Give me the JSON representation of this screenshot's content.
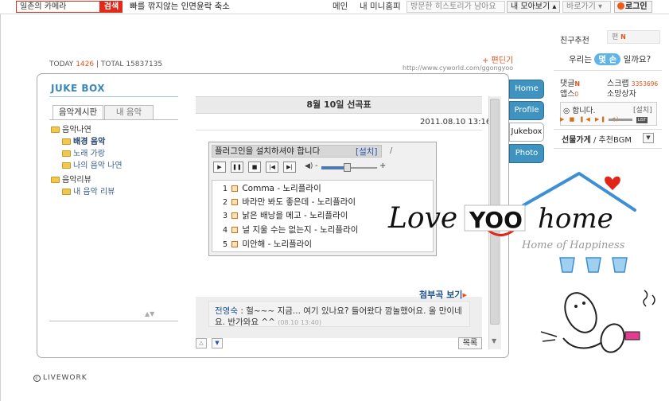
{
  "topbar": {
    "search_value": "일촌의 카메라",
    "search_button": "검색",
    "news": "빠를 깎지않는 인면윤락 축소",
    "nav_main": "메인",
    "nav_minihompy": "내 미니홈피",
    "history_placeholder": "방문한 히스토리가 남아요",
    "collect": "내 모아보기",
    "shortcut": "바로가기",
    "login": "로그인"
  },
  "counter": {
    "today_label": "TODAY",
    "today_value": "1426",
    "total_label": "TOTAL",
    "total_value": "15837135"
  },
  "url": "http://www.cyworld.com/ggongyoo",
  "edit_link": "+ 편딘기",
  "jukebox": {
    "title": "JUKE BOX",
    "tabs": [
      "음악게시판",
      "내 음악"
    ],
    "tree": [
      {
        "label": "음악나연",
        "type": "folder"
      },
      {
        "label": "배경 음악",
        "type": "sub",
        "active": true
      },
      {
        "label": "노래 가랑",
        "type": "sub"
      },
      {
        "label": "나의 음악 나연",
        "type": "sub"
      },
      {
        "label": "음악리뷰",
        "type": "folder"
      },
      {
        "label": "내 음악 리뷰",
        "type": "sub"
      }
    ]
  },
  "post": {
    "title": "8월 10일 선곡표",
    "date": "2011.08.10 13:16",
    "player_notice": "플러그인을 설치하셔야 합니다",
    "player_setup": "[설치]",
    "player_slash": "/",
    "controls": [
      "▶",
      "❚❚",
      "■",
      "|◀",
      "▶|"
    ],
    "vol_minus": "-",
    "vol_plus": "+",
    "volume_percent": 45,
    "tracks": [
      {
        "num": "1",
        "title": "Comma - 노리플라이"
      },
      {
        "num": "2",
        "title": "바라만 봐도 좋은데 - 노리플라이"
      },
      {
        "num": "3",
        "title": "낡은 배낭을 메고 - 노리플라이"
      },
      {
        "num": "4",
        "title": "널 지울 수는 없는지 - 노리플라이"
      },
      {
        "num": "5",
        "title": "미안해 - 노리플라이"
      }
    ],
    "attach": "첨부곡 보기",
    "comment": {
      "author": "전영숙",
      "text": " : 헐~~~ 지금... 여기 있나요? 들어왔다 깜놀했어요. 올 만이네요. 반가와요 ^^ ",
      "time": "(08.10 13:40)"
    },
    "list_button": "목록"
  },
  "side_tabs": [
    {
      "label": "Home",
      "active": false
    },
    {
      "label": "Profile",
      "active": false
    },
    {
      "label": "Jukebox",
      "active": true
    },
    {
      "label": "Photo",
      "active": false
    }
  ],
  "footer": {
    "brand": "LIVEWORK",
    "icon": "copyright-icon"
  },
  "sidebar": {
    "friend_rec": "친구추천",
    "friend_box": "편",
    "new_mark": "N",
    "we_are_prefix": "우리는",
    "days": "몇 손",
    "we_are_suffix": "일까요?",
    "stats": [
      {
        "label": "댓글",
        "value": "N"
      },
      {
        "label": "스크랩",
        "value": "3353696"
      },
      {
        "label": "앱스",
        "value": "0"
      },
      {
        "label": "소망상자",
        "value": ""
      }
    ],
    "mini_player_label": "합니다.",
    "mini_player_setup": "[설치]",
    "mini_list": "LIST",
    "gift": "선물가게",
    "gift_suffix": " / 추천BGM"
  },
  "decoration": {
    "love": "Love",
    "yoo": "YOO",
    "home": "home",
    "tagline": "Home of Happiness"
  },
  "colors": {
    "accent_blue": "#3f93c1",
    "search_red": "#e02a1a",
    "new_orange": "#e2521b",
    "link_blue": "#1b4f8e"
  }
}
